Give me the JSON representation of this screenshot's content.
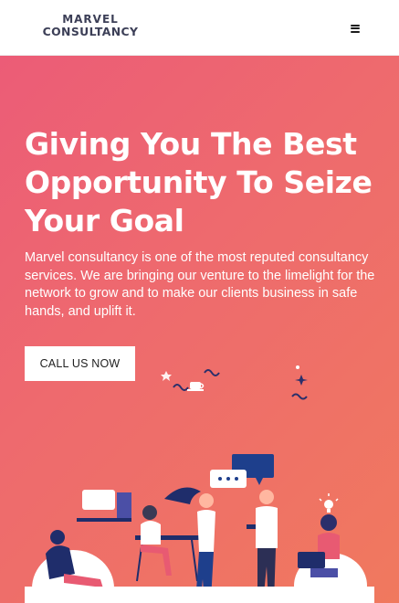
{
  "brand": {
    "line1": "MARVEL",
    "line2": "CONSULTANCY"
  },
  "nav": {
    "menu_icon": "hamburger-menu-icon"
  },
  "hero": {
    "title": "Giving You The Best Opportunity To Seize Your Goal",
    "description": "Marvel consultancy is one of the most reputed consultancy services. We are bringing our venture to the limelight for the network to grow and to make our clients business in safe hands, and uplift it.",
    "cta_label": "CALL US NOW"
  },
  "colors": {
    "hero_gradient_start": "#ec5c77",
    "hero_gradient_end": "#f0795e",
    "brand_text": "#3c3f57",
    "chat_bubble_blue": "#1e3f8c",
    "illustration_navy": "#1f2d6b"
  }
}
